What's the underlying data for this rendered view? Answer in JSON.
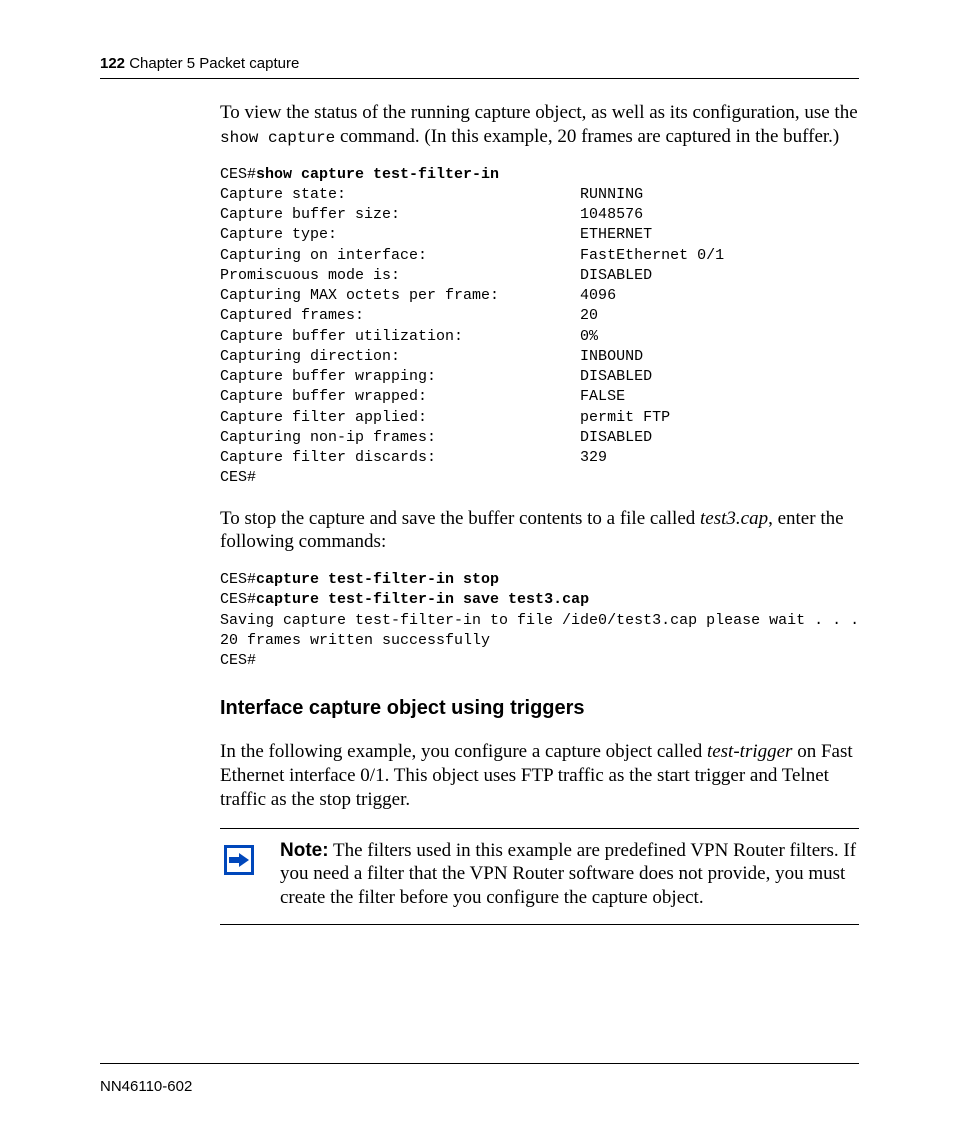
{
  "header": {
    "page_number": "122",
    "chapter": "Chapter 5  Packet capture"
  },
  "p1_a": "To view the status of the running capture object, as well as its configuration, use the ",
  "p1_cmd": "show capture",
  "p1_b": " command. (In this example, 20 frames are captured in the buffer.)",
  "block1": {
    "prompt1": "CES#",
    "cmd1": "show capture test-filter-in",
    "rows": [
      {
        "label": "Capture state:",
        "value": "RUNNING"
      },
      {
        "label": "Capture buffer size:",
        "value": "1048576"
      },
      {
        "label": "Capture type:",
        "value": "ETHERNET"
      },
      {
        "label": "Capturing on interface:",
        "value": "FastEthernet 0/1"
      },
      {
        "label": "Promiscuous mode is:",
        "value": "DISABLED"
      },
      {
        "label": "Capturing MAX octets per frame:",
        "value": "4096"
      },
      {
        "label": "Captured frames:",
        "value": "20"
      },
      {
        "label": "Capture buffer utilization:",
        "value": "0%"
      },
      {
        "label": "Capturing direction:",
        "value": "INBOUND"
      },
      {
        "label": "Capture buffer wrapping:",
        "value": "DISABLED"
      },
      {
        "label": "Capture buffer wrapped:",
        "value": "FALSE"
      },
      {
        "label": "Capture filter applied:",
        "value": "permit FTP"
      },
      {
        "label": "Capturing non-ip frames:",
        "value": "DISABLED"
      },
      {
        "label": "Capture filter discards:",
        "value": "329"
      }
    ],
    "tail": "CES#"
  },
  "p2_a": "To stop the capture and save the buffer contents to a file called ",
  "p2_file": "test3.cap",
  "p2_b": ", enter the following commands:",
  "block2": {
    "l1_prompt": "CES#",
    "l1_cmd": "capture test-filter-in stop",
    "l2_prompt": "CES#",
    "l2_cmd": "capture test-filter-in save test3.cap",
    "l3": "Saving capture test-filter-in to file /ide0/test3.cap please wait . . .",
    "l4": "20 frames written successfully",
    "l5": "CES#"
  },
  "section_heading": "Interface capture object using triggers",
  "p3_a": "In the following example, you configure a capture object called ",
  "p3_obj": "test-trigger",
  "p3_b": " on Fast Ethernet interface 0/1. This object uses FTP traffic as the start trigger and Telnet traffic as the stop trigger.",
  "note": {
    "label": "Note:",
    "text": " The filters used in this example are predefined VPN Router filters. If you need a filter that the VPN Router software does not provide, you must create the filter before you configure the capture object."
  },
  "footer": "NN46110-602"
}
